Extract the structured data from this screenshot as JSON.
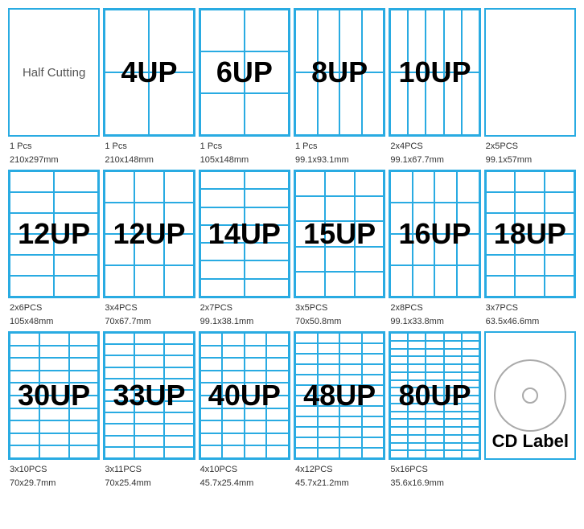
{
  "rows": [
    {
      "cells": [
        {
          "id": "half-cutting",
          "label": "Half Cutting",
          "gridCols": 1,
          "gridRows": 1,
          "type": "text-only",
          "info1": "1 Pcs",
          "info2": "210x297mm"
        },
        {
          "id": "4up",
          "label": "4UP",
          "gridCols": 2,
          "gridRows": 2,
          "type": "grid",
          "info1": "1 Pcs",
          "info2": "210x148mm"
        },
        {
          "id": "6up",
          "label": "6UP",
          "gridCols": 2,
          "gridRows": 3,
          "type": "grid",
          "info1": "1 Pcs",
          "info2": "105x148mm"
        },
        {
          "id": "8up",
          "label": "8UP",
          "gridCols": 4,
          "gridRows": 2,
          "type": "grid",
          "info1": "1 Pcs",
          "info2": "99.1x93.1mm"
        },
        {
          "id": "10up",
          "label": "10UP",
          "gridCols": 5,
          "gridRows": 2,
          "type": "grid",
          "info1": "2x4PCS",
          "info2": "99.1x67.7mm"
        },
        {
          "id": "dummy1",
          "label": "",
          "type": "empty-right",
          "info1": "2x5PCS",
          "info2": "99.1x57mm"
        }
      ]
    },
    {
      "cells": [
        {
          "id": "12up-a",
          "label": "12UP",
          "gridCols": 2,
          "gridRows": 6,
          "type": "grid",
          "info1": "2x6PCS",
          "info2": "105x48mm"
        },
        {
          "id": "12up-b",
          "label": "12UP",
          "gridCols": 3,
          "gridRows": 4,
          "type": "grid",
          "info1": "3x4PCS",
          "info2": "70x67.7mm"
        },
        {
          "id": "14up",
          "label": "14UP",
          "gridCols": 2,
          "gridRows": 7,
          "type": "grid",
          "info1": "2x7PCS",
          "info2": "99.1x38.1mm"
        },
        {
          "id": "15up",
          "label": "15UP",
          "gridCols": 3,
          "gridRows": 5,
          "type": "grid",
          "info1": "3x5PCS",
          "info2": "70x50.8mm"
        },
        {
          "id": "16up",
          "label": "16UP",
          "gridCols": 4,
          "gridRows": 4,
          "type": "grid",
          "info1": "2x8PCS",
          "info2": "99.1x33.8mm"
        },
        {
          "id": "18up",
          "label": "18UP",
          "gridCols": 3,
          "gridRows": 6,
          "type": "grid",
          "info1": "3x7PCS",
          "info2": "63.5x46.6mm"
        }
      ]
    },
    {
      "cells": [
        {
          "id": "30up",
          "label": "30UP",
          "gridCols": 3,
          "gridRows": 10,
          "type": "grid",
          "info1": "3x10PCS",
          "info2": "70x29.7mm"
        },
        {
          "id": "33up",
          "label": "33UP",
          "gridCols": 3,
          "gridRows": 11,
          "type": "grid",
          "info1": "3x11PCS",
          "info2": "70x25.4mm"
        },
        {
          "id": "40up",
          "label": "40UP",
          "gridCols": 4,
          "gridRows": 10,
          "type": "grid",
          "info1": "4x10PCS",
          "info2": "45.7x25.4mm"
        },
        {
          "id": "48up",
          "label": "48UP",
          "gridCols": 4,
          "gridRows": 12,
          "type": "grid",
          "info1": "4x12PCS",
          "info2": "45.7x21.2mm"
        },
        {
          "id": "80up",
          "label": "80UP",
          "gridCols": 5,
          "gridRows": 16,
          "type": "grid",
          "info1": "5x16PCS",
          "info2": "35.6x16.9mm"
        },
        {
          "id": "cdlabel",
          "label": "CD Label",
          "type": "cd",
          "info1": "",
          "info2": ""
        }
      ]
    }
  ]
}
